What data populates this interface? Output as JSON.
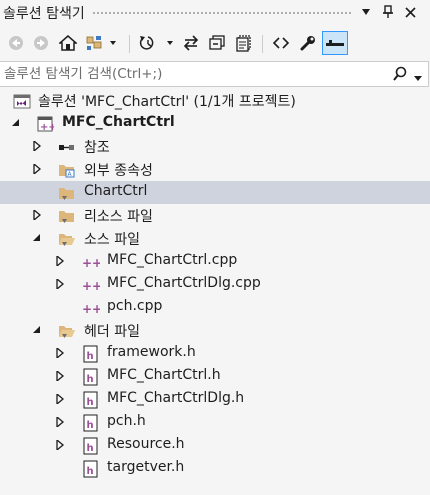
{
  "window": {
    "title": "솔루션 탐색기"
  },
  "title_buttons": {
    "dropdown_icon": "▾",
    "pin_icon": "pin-icon",
    "close_icon": "✕"
  },
  "toolbar": {
    "icons": [
      "back-icon",
      "forward-icon",
      "home-icon",
      "switch-views-icon",
      "pending-changes-filter-icon",
      "sync-icon",
      "collapse-all-icon",
      "show-all-files-icon",
      "view-code-icon",
      "properties-icon",
      "preview-selected-icon"
    ]
  },
  "search": {
    "placeholder": "솔루션 탐색기 검색(Ctrl+;)"
  },
  "tree": {
    "solution": "솔루션 'MFC_ChartCtrl' (1/1개 프로젝트)",
    "project": "MFC_ChartCtrl",
    "references": "참조",
    "external_deps": "외부 종속성",
    "chartctrl": "ChartCtrl",
    "resource_files": "리소스 파일",
    "source_files": "소스 파일",
    "source_items": [
      "MFC_ChartCtrl.cpp",
      "MFC_ChartCtrlDlg.cpp",
      "pch.cpp"
    ],
    "header_files": "헤더 파일",
    "header_items": [
      "framework.h",
      "MFC_ChartCtrl.h",
      "MFC_ChartCtrlDlg.h",
      "pch.h",
      "Resource.h",
      "targetver.h"
    ]
  },
  "colors": {
    "selected_row": "#cfd3dd",
    "folder": "#dcb67a",
    "vs_purple": "#68217a",
    "cpp_purple": "#9b4f96",
    "active_button": "#cce4f7"
  }
}
